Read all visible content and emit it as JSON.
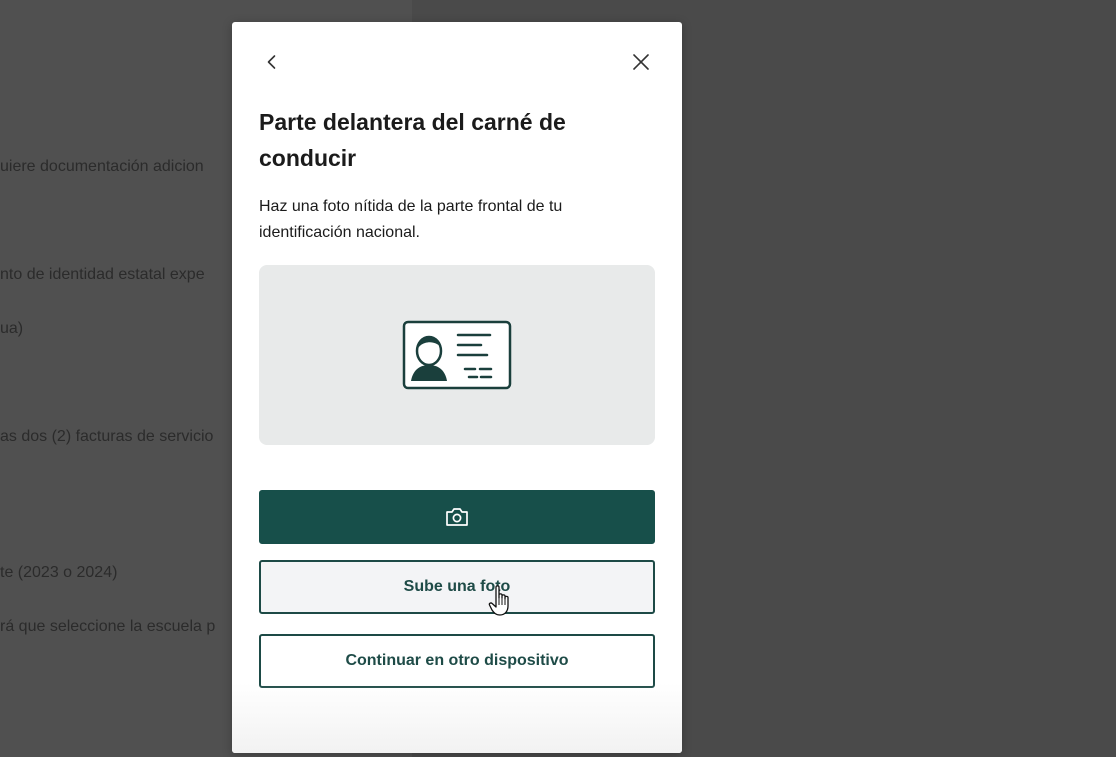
{
  "background": {
    "lines": [
      "uiere documentación adicion",
      "nto de identidad estatal expe",
      "ua)",
      "as dos (2) facturas de servicio",
      "te (2023 o 2024)",
      "rá que seleccione la escuela p"
    ]
  },
  "modal": {
    "title": "Parte delantera del carné de conducir",
    "description": "Haz una foto nítida de la parte frontal de tu identificación nacional.",
    "buttons": {
      "upload_label": "Sube una foto",
      "continue_label": "Continuar en otro dispositivo"
    }
  },
  "icons": {
    "back": "chevron-left-icon",
    "close": "close-icon",
    "illustration": "id-card-icon",
    "camera": "camera-icon",
    "cursor": "hand-pointer-icon"
  },
  "colors": {
    "primary": "#174f4a",
    "illustration_bg": "#e8eaea",
    "backdrop": "#4a4a4a"
  }
}
